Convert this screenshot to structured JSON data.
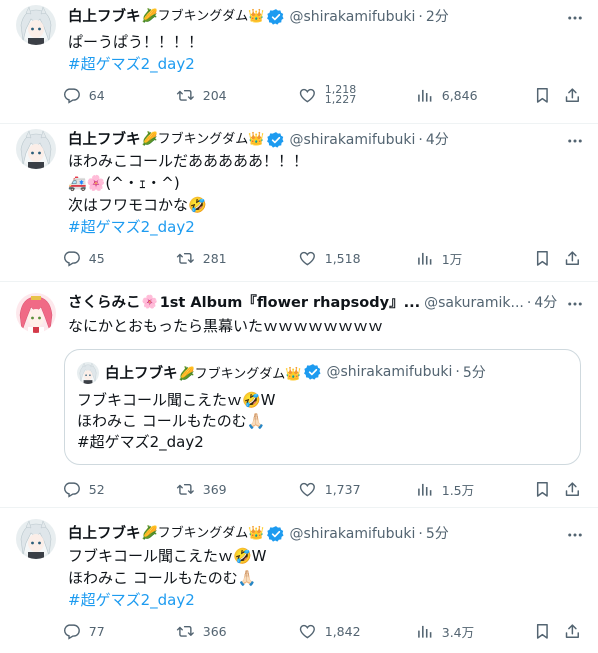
{
  "colors": {
    "accent": "#1d9bf0",
    "secondary_text": "#536471",
    "verified": "#1d9bf0",
    "border": "#cfd9de"
  },
  "tweets": [
    {
      "display_name": "白上フブキ",
      "name_emoji": "🌽フブキングダム👑",
      "handle": "@shirakamifubuki",
      "time": "2分",
      "lines": [
        "ぱーうぱう！！！！"
      ],
      "hashtag": "#超ゲマズ2_day2",
      "replies": "64",
      "retweets": "204",
      "likes_old": "1,218",
      "likes_new": "1,227",
      "views": "6,846"
    },
    {
      "display_name": "白上フブキ",
      "name_emoji": "🌽フブキングダム👑",
      "handle": "@shirakamifubuki",
      "time": "4分",
      "lines": [
        "ほわみこコールだあああああ！！！",
        "🚑🌸(^・ｪ・^)",
        "次はフワモコかな🤣"
      ],
      "hashtag": "#超ゲマズ2_day2",
      "replies": "45",
      "retweets": "281",
      "likes": "1,518",
      "views": "1万"
    },
    {
      "display_name": "さくらみこ",
      "name_emoji": "🌸",
      "name_rest": "1st Album『flower rhapsody』...",
      "handle": "@sakuramik...",
      "time": "4分",
      "lines": [
        "なにかとおもったら黒幕いたｗｗｗｗｗｗｗｗ"
      ],
      "quote": {
        "display_name": "白上フブキ",
        "name_emoji": "🌽フブキングダム👑",
        "handle": "@shirakamifubuki",
        "time": "5分",
        "lines": [
          "フブキコール聞こえたｗ🤣W",
          "ほわみこ コールもたのむ🙏🏻",
          " #超ゲマズ2_day2"
        ]
      },
      "replies": "52",
      "retweets": "369",
      "likes": "1,737",
      "views": "1.5万"
    },
    {
      "display_name": "白上フブキ",
      "name_emoji": "🌽フブキングダム👑",
      "handle": "@shirakamifubuki",
      "time": "5分",
      "lines": [
        "フブキコール聞こえたｗ🤣W",
        "ほわみこ コールもたのむ🙏🏻"
      ],
      "hashtag": "#超ゲマズ2_day2",
      "replies": "77",
      "retweets": "366",
      "likes": "1,842",
      "views": "3.4万"
    }
  ],
  "icons": {
    "reply": "reply-icon",
    "retweet": "retweet-icon",
    "like": "heart-icon",
    "views": "views-icon",
    "bookmark": "bookmark-icon",
    "share": "share-icon",
    "more": "more-icon",
    "verified": "verified-badge-icon"
  }
}
